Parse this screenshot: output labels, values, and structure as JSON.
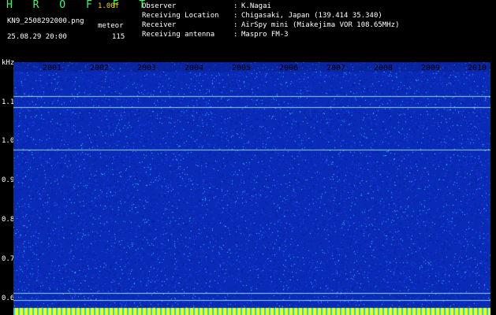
{
  "header": {
    "title": "H R O F F T",
    "version": "1.00f",
    "filename": "KN9_2508292000.png",
    "meteor_label": "meteor",
    "datetime": "25.08.29 20:00",
    "meteor_count": "115"
  },
  "meta": [
    {
      "key": "Observer",
      "value": "K.Nagai"
    },
    {
      "key": "Receiving Location",
      "value": "Chigasaki, Japan (139.414 35.340)"
    },
    {
      "key": "Receiver",
      "value": "AirSpy mini (Miakejima VOR 108.65MHz)"
    },
    {
      "key": "Receiving antenna",
      "value": "Maspro FM-3"
    }
  ],
  "spectrogram": {
    "y_unit": "kHz",
    "y_ticks": [
      "1.1",
      "1.0",
      "0.9",
      "0.8",
      "0.7",
      "0.6"
    ],
    "x_ticks": [
      "2001",
      "2002",
      "2003",
      "2004",
      "2005",
      "2006",
      "2007",
      "2008",
      "2009",
      "2010"
    ],
    "colors": {
      "background": "#0a2ab8",
      "noise_dark": "#001e8c",
      "noise_mid": "#2a4cff",
      "noise_bright": "#27c8ff",
      "carrier": "#b0ffe0",
      "baseline_a": "#ffff00",
      "baseline_b": "#00d8ff"
    }
  }
}
